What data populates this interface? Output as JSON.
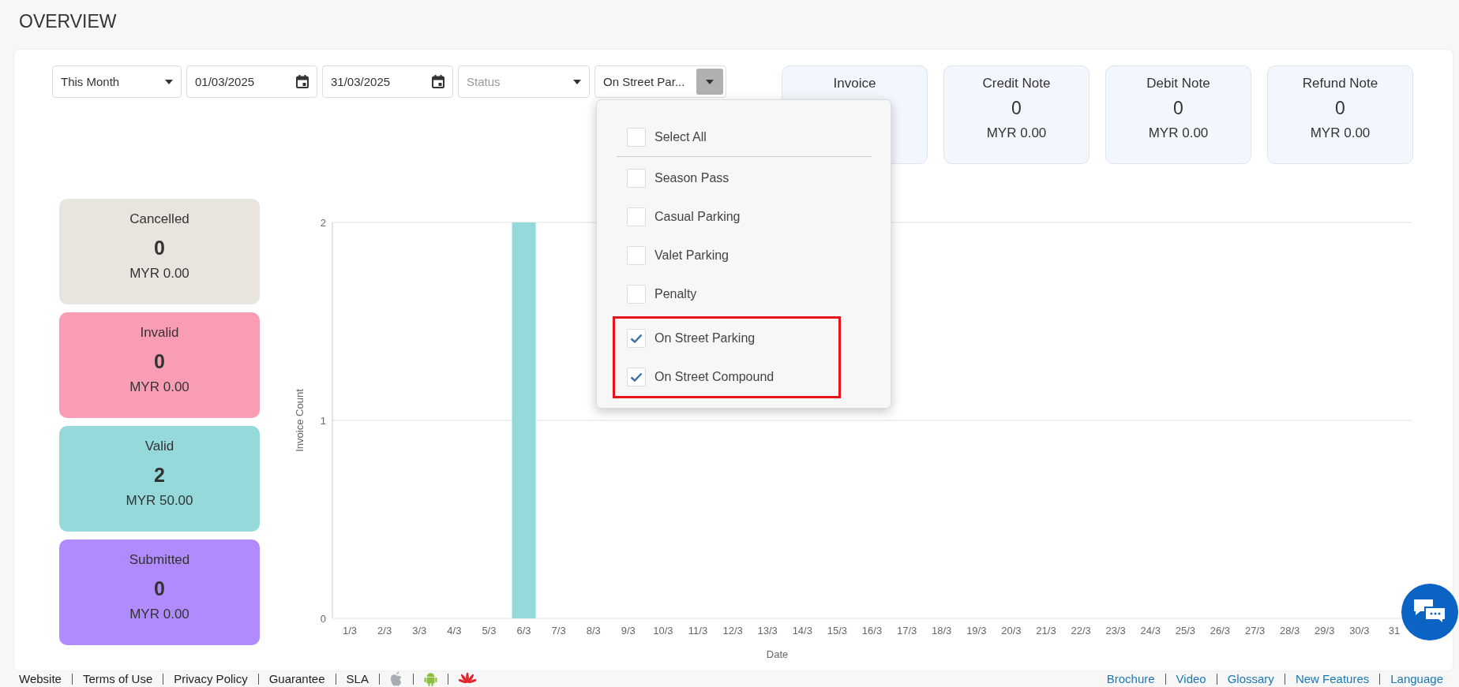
{
  "page": {
    "title": "OVERVIEW"
  },
  "filters": {
    "period": {
      "value": "This Month"
    },
    "start_date": {
      "value": "01/03/2025"
    },
    "end_date": {
      "value": "31/03/2025"
    },
    "status": {
      "placeholder": "Status"
    },
    "category": {
      "value": "On Street Par...",
      "expanded": true
    }
  },
  "category_options": {
    "select_all": {
      "label": "Select All",
      "checked": false
    },
    "items": [
      {
        "label": "Season Pass",
        "checked": false,
        "highlighted": false
      },
      {
        "label": "Casual Parking",
        "checked": false,
        "highlighted": false
      },
      {
        "label": "Valet Parking",
        "checked": false,
        "highlighted": false
      },
      {
        "label": "Penalty",
        "checked": false,
        "highlighted": false
      },
      {
        "label": "On Street Parking",
        "checked": true,
        "highlighted": true
      },
      {
        "label": "On Street Compound",
        "checked": true,
        "highlighted": true
      }
    ]
  },
  "summary_cards": [
    {
      "title": "Invoice"
    },
    {
      "title": "Credit Note",
      "count": "0",
      "amount": "MYR 0.00"
    },
    {
      "title": "Debit Note",
      "count": "0",
      "amount": "MYR 0.00"
    },
    {
      "title": "Refund Note",
      "count": "0",
      "amount": "MYR 0.00"
    }
  ],
  "status_cards": [
    {
      "title": "Cancelled",
      "count": "0",
      "amount": "MYR 0.00",
      "color": "#e8e5df"
    },
    {
      "title": "Invalid",
      "count": "0",
      "amount": "MYR 0.00",
      "color": "#f99db5"
    },
    {
      "title": "Valid",
      "count": "2",
      "amount": "MYR 50.00",
      "color": "#95d9da"
    },
    {
      "title": "Submitted",
      "count": "0",
      "amount": "MYR 0.00",
      "color": "#af8bfd"
    }
  ],
  "chart": {
    "chart_data": {
      "type": "bar",
      "xlabel": "Date",
      "ylabel": "Invoice Count",
      "categories": [
        "1/3",
        "2/3",
        "3/3",
        "4/3",
        "5/3",
        "6/3",
        "7/3",
        "8/3",
        "9/3",
        "10/3",
        "11/3",
        "12/3",
        "13/3",
        "14/3",
        "15/3",
        "16/3",
        "17/3",
        "18/3",
        "19/3",
        "20/3",
        "21/3",
        "22/3",
        "23/3",
        "24/3",
        "25/3",
        "26/3",
        "27/3",
        "28/3",
        "29/3",
        "30/3",
        "31"
      ],
      "values": [
        0,
        0,
        0,
        0,
        0,
        2,
        0,
        0,
        0,
        0,
        0,
        0,
        0,
        0,
        0,
        0,
        0,
        0,
        0,
        0,
        0,
        0,
        0,
        0,
        0,
        0,
        0,
        0,
        0,
        0,
        0
      ],
      "ylim": [
        0,
        2
      ],
      "yticks": [
        0,
        1,
        2
      ]
    }
  },
  "footer": {
    "left_links": [
      "Website",
      "Terms of Use",
      "Privacy Policy",
      "Guarantee",
      "SLA"
    ],
    "right_links": [
      "Brochure",
      "Video",
      "Glossary",
      "New Features",
      "Language"
    ]
  }
}
